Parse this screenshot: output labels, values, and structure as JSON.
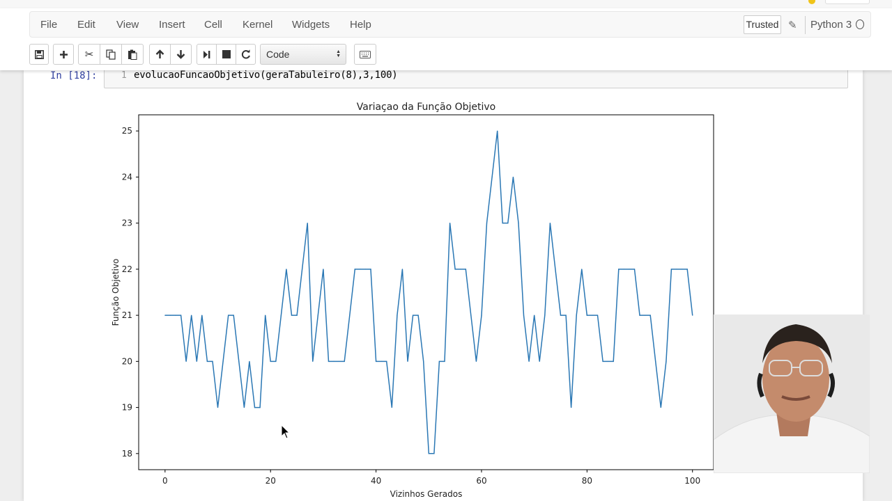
{
  "menu": {
    "items": [
      "File",
      "Edit",
      "View",
      "Insert",
      "Cell",
      "Kernel",
      "Widgets",
      "Help"
    ],
    "trusted_label": "Trusted",
    "kernel_name": "Python 3"
  },
  "toolbar": {
    "buttons": [
      "save-icon",
      "plus-icon",
      "cut-icon",
      "copy-icon",
      "paste-icon",
      "arrow-up-icon",
      "arrow-down-icon",
      "run-icon",
      "stop-icon",
      "restart-icon",
      "keyboard-icon"
    ],
    "cell_type": "Code"
  },
  "cell": {
    "prompt": "In [18]:",
    "line_number": "1",
    "code": "evolucaoFuncaoObjetivo(geraTabuleiro(8),3,100)"
  },
  "colors": {
    "line": "#2a77b4",
    "prompt": "#303f9f"
  },
  "chart_data": {
    "type": "line",
    "title": "Variaçao da Função Objetivo",
    "xlabel": "Vizinhos Gerados",
    "ylabel": "Função Objetivo",
    "xlim": [
      -5,
      104
    ],
    "ylim": [
      17.65,
      25.35
    ],
    "xticks": [
      0,
      20,
      40,
      60,
      80,
      100
    ],
    "yticks": [
      18,
      19,
      20,
      21,
      22,
      23,
      24,
      25
    ],
    "grid": false,
    "series": [
      {
        "values": [
          21,
          21,
          21,
          21,
          20,
          21,
          20,
          21,
          20,
          20,
          19,
          20,
          21,
          21,
          20,
          19,
          20,
          19,
          19,
          21,
          20,
          20,
          21,
          22,
          21,
          21,
          22,
          23,
          20,
          21,
          22,
          20,
          20,
          20,
          20,
          21,
          22,
          22,
          22,
          22,
          20,
          20,
          20,
          19,
          21,
          22,
          20,
          21,
          21,
          20,
          18,
          18,
          20,
          20,
          23,
          22,
          22,
          22,
          21,
          20,
          21,
          23,
          24,
          25,
          23,
          23,
          24,
          23,
          21,
          20,
          21,
          20,
          21,
          23,
          22,
          21,
          21,
          19,
          21,
          22,
          21,
          21,
          21,
          20,
          20,
          20,
          22,
          22,
          22,
          22,
          21,
          21,
          21,
          20,
          19,
          20,
          22,
          22,
          22,
          22,
          21
        ]
      }
    ]
  }
}
